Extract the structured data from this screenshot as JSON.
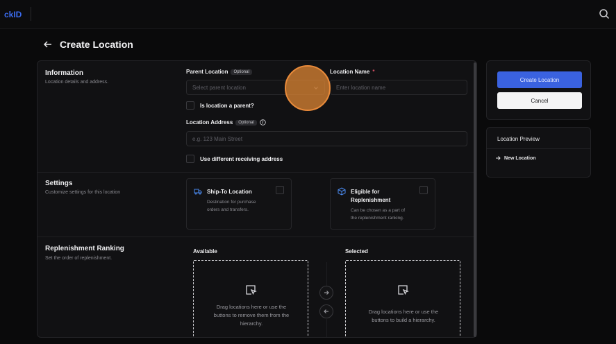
{
  "topbar": {
    "logo": "ckID"
  },
  "page": {
    "title": "Create Location"
  },
  "info": {
    "title": "Information",
    "desc": "Location details and address.",
    "parent_label": "Parent Location",
    "optional": "Optional",
    "parent_placeholder": "Select parent location",
    "name_label": "Location Name",
    "required_mark": "*",
    "name_placeholder": "Enter location name",
    "is_parent_label": "Is location a parent?",
    "address_label": "Location Address",
    "address_placeholder": "e.g. 123 Main Street",
    "diff_address_label": "Use different receiving address"
  },
  "settings": {
    "title": "Settings",
    "desc": "Customize settings for this location",
    "shipto_title": "Ship-To Location",
    "shipto_desc1": "Destination for purchase",
    "shipto_desc2": "orders and transfers.",
    "repl_title1": "Eligible for",
    "repl_title2": "Replenishment",
    "repl_desc1": "Can be chosen as a part of",
    "repl_desc2": "the replenishment ranking."
  },
  "ranking": {
    "title": "Replenishment Ranking",
    "desc": "Set the order of replenishment.",
    "available": "Available",
    "selected": "Selected",
    "avail_text1": "Drag locations here or use the",
    "avail_text2": "buttons to remove them from the",
    "avail_text3": "hierarchy.",
    "sel_text1": "Drag locations here or use the",
    "sel_text2": "buttons to build a hierarchy."
  },
  "actions": {
    "create": "Create Location",
    "cancel": "Cancel"
  },
  "preview": {
    "title": "Location Preview",
    "item": "New Location"
  }
}
